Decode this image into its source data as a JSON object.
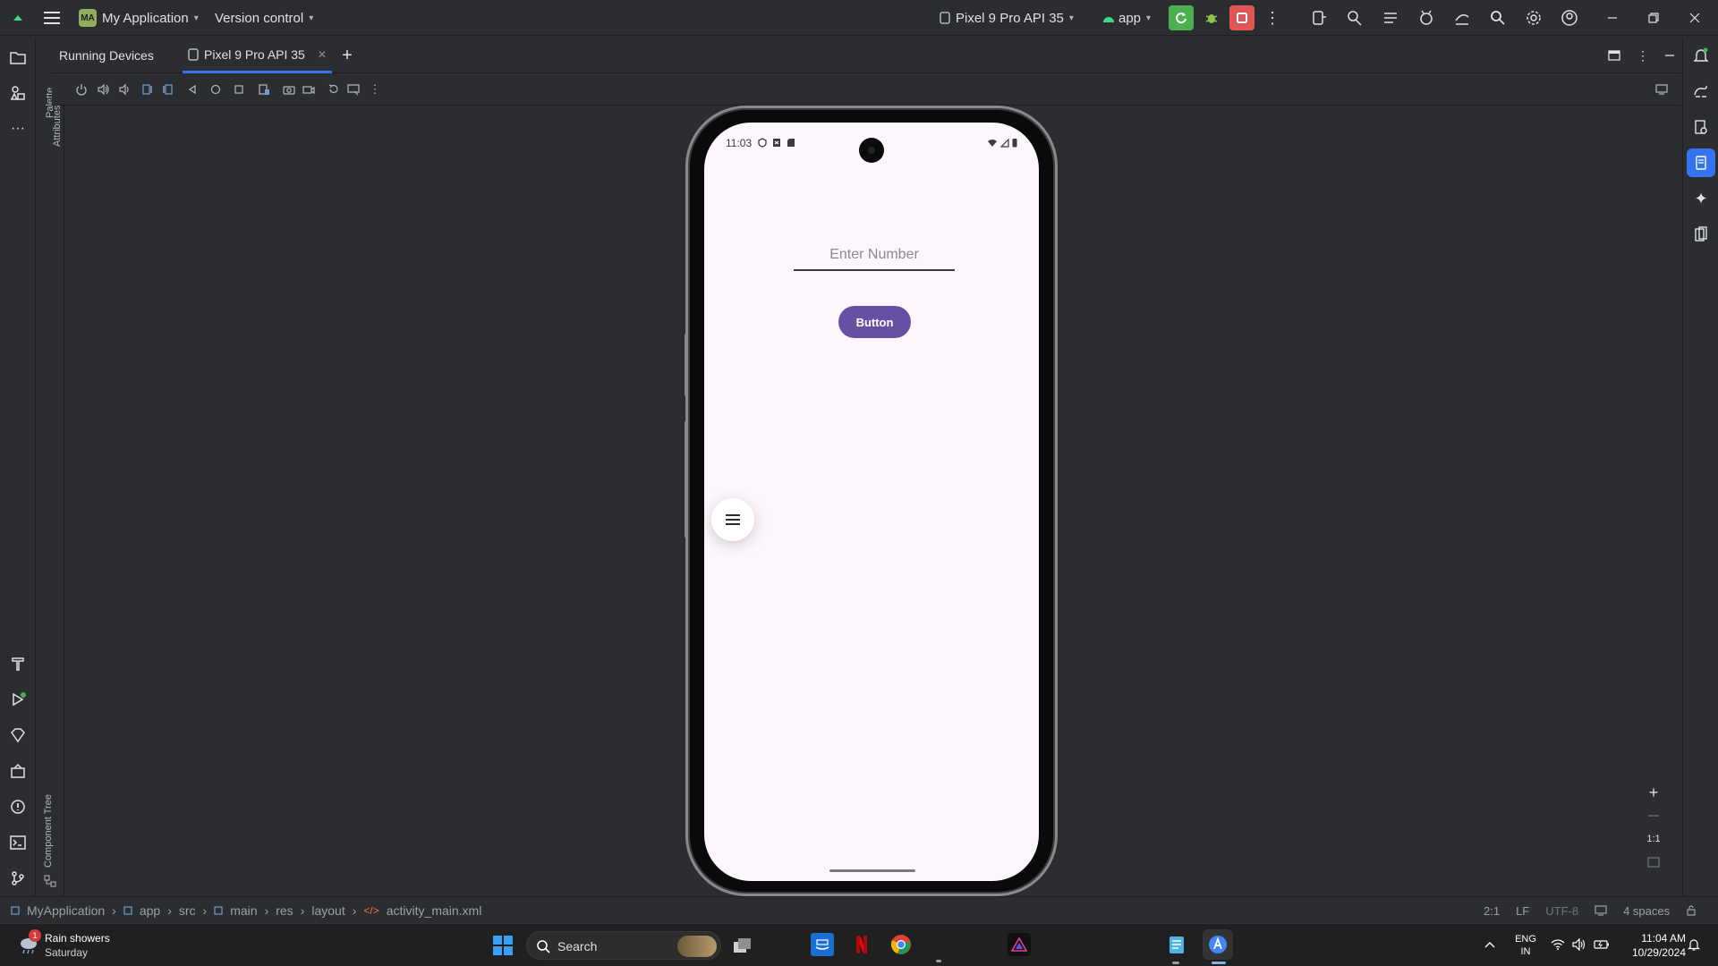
{
  "titlebar": {
    "project_badge": "MA",
    "project_name": "My Application",
    "vcs": "Version control",
    "device": "Pixel 9 Pro API 35",
    "run_config": "app"
  },
  "tabs": {
    "running_devices": "Running Devices",
    "device_tab": "Pixel 9 Pro API 35"
  },
  "side": {
    "palette": "Palette",
    "attributes": "Attributes",
    "component_tree": "Component Tree"
  },
  "phone": {
    "time": "11:03",
    "input_placeholder": "Enter Number",
    "button_label": "Button"
  },
  "zoom": {
    "ratio": "1:1"
  },
  "breadcrumb": [
    "MyApplication",
    "app",
    "src",
    "main",
    "res",
    "layout",
    "activity_main.xml"
  ],
  "status": {
    "position": "2:1",
    "line_sep": "LF",
    "encoding": "UTF-8",
    "indent": "4 spaces"
  },
  "taskbar": {
    "weather_badge": "1",
    "weather_title": "Rain showers",
    "weather_sub": "Saturday",
    "search": "Search",
    "lang_top": "ENG",
    "lang_bottom": "IN",
    "time": "11:04 AM",
    "date": "10/29/2024"
  },
  "colors": {
    "accent": "#6750a4",
    "run_green": "#4caf50",
    "stop_red": "#e05555",
    "ide_bg": "#2b2d30",
    "screen_bg": "#fdf7fd"
  }
}
